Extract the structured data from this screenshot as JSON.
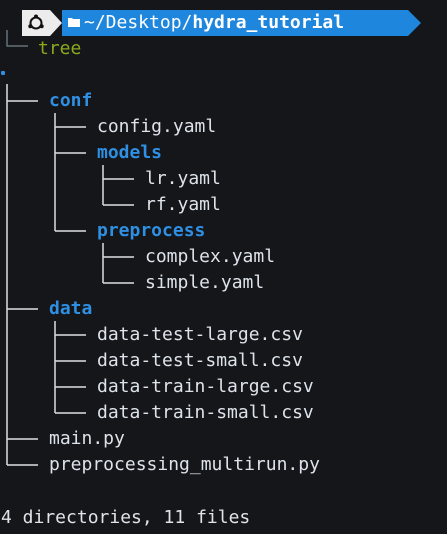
{
  "prompt": {
    "path_prefix": "~/Desktop/",
    "path_current": "hydra_tutorial",
    "distro_icon": "ubuntu-icon",
    "folder_icon": "folder-icon",
    "command": "tree"
  },
  "tree": {
    "root": ".",
    "conf": "conf",
    "config_yaml": "config.yaml",
    "models": "models",
    "lr_yaml": "lr.yaml",
    "rf_yaml": "rf.yaml",
    "preprocess": "preprocess",
    "complex_yaml": "complex.yaml",
    "simple_yaml": "simple.yaml",
    "data": "data",
    "data_test_large": "data-test-large.csv",
    "data_test_small": "data-test-small.csv",
    "data_train_large": "data-train-large.csv",
    "data_train_small": "data-train-small.csv",
    "main_py": "main.py",
    "preprocessing_multirun_py": "preprocessing_multirun.py"
  },
  "summary": "4 directories, 11 files",
  "colors": {
    "background": "#14161a",
    "directory": "#2f8fe3",
    "command": "#8aa91b",
    "prompt_path_bg": "#1f86dd"
  }
}
